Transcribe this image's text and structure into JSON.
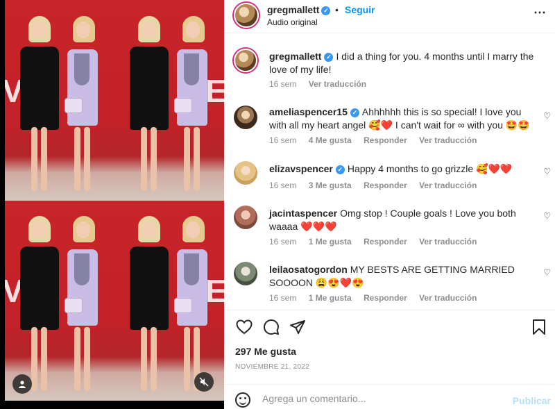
{
  "media": {
    "backdrop_text": "VE"
  },
  "header": {
    "username": "gregmallett",
    "separator": "•",
    "follow_label": "Seguir",
    "subtitle": "Audio original",
    "more_icon": "more-horizontal-icon"
  },
  "caption": {
    "username": "gregmallett",
    "text": "I did a thing for you. 4 months until I marry the love of my life!",
    "time": "16 sem",
    "translate": "Ver traducción"
  },
  "comments": [
    {
      "username": "ameliaspencer15",
      "verified": true,
      "text": "Ahhhhhh this is so special! I love you with all my heart angel 🥰❤️ I can't wait for ∞ with you 🤩🤩",
      "time": "16 sem",
      "likes": "4 Me gusta",
      "reply": "Responder",
      "translate": "Ver traducción"
    },
    {
      "username": "elizavspencer",
      "verified": true,
      "text": "Happy 4 months to go grizzle 🥰❤️❤️",
      "time": "16 sem",
      "likes": "3 Me gusta",
      "reply": "Responder",
      "translate": "Ver traducción"
    },
    {
      "username": "jacintaspencer",
      "verified": false,
      "text": "Omg stop ! Couple goals ! Love you both waaaa ❤️❤️❤️",
      "time": "16 sem",
      "likes": "1 Me gusta",
      "reply": "Responder",
      "translate": "Ver traducción"
    },
    {
      "username": "leilaosatogordon",
      "verified": false,
      "text": "MY BESTS ARE GETTING MARRIED SOOOON 😩😍❤️😍",
      "time": "16 sem",
      "likes": "1 Me gusta",
      "reply": "Responder",
      "translate": "Ver traducción"
    }
  ],
  "footer": {
    "likes": "297 Me gusta",
    "date": "NOVIEMBRE 21, 2022",
    "comment_placeholder": "Agrega un comentario...",
    "publish_label": "Publicar"
  },
  "colors": {
    "accent": "#0095f6",
    "verified": "#3897f0",
    "muted": "#8e8e8e",
    "publish_disabled": "#b2dffc"
  }
}
